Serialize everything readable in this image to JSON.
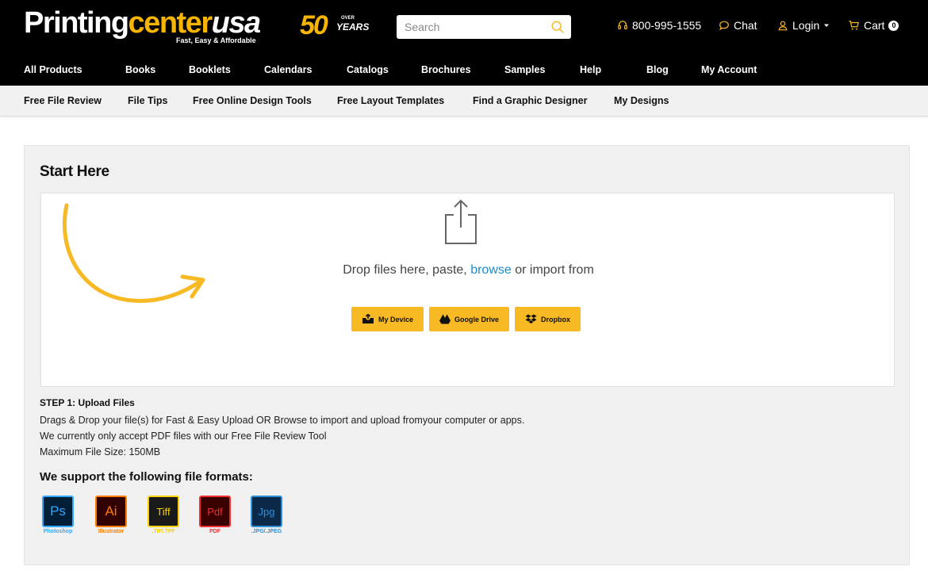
{
  "header": {
    "logo": {
      "part1": "Printing",
      "part2": "center",
      "part3": "usa",
      "tagline": "Fast, Easy & Affordable"
    },
    "anniversary": {
      "number": "50",
      "over": "OVER",
      "years": "YEARS"
    },
    "search": {
      "placeholder": "Search",
      "value": ""
    },
    "phone": "800-995-1555",
    "chat": "Chat",
    "login": "Login",
    "cart": {
      "label": "Cart",
      "count": "0"
    }
  },
  "main_nav": [
    "All Products",
    "Books",
    "Booklets",
    "Calendars",
    "Catalogs",
    "Brochures",
    "Samples",
    "Help",
    "Blog",
    "My Account"
  ],
  "sub_nav": [
    "Free File Review",
    "File Tips",
    "Free Online Design Tools",
    "Free Layout Templates",
    "Find a Graphic Designer",
    "My Designs"
  ],
  "upload": {
    "title": "Start Here",
    "drop_prefix": "Drop files here, paste, ",
    "browse": "browse",
    "drop_suffix": " or import from",
    "buttons": {
      "device": "My Device",
      "gdrive": "Google Drive",
      "dropbox": "Dropbox"
    }
  },
  "step": {
    "title": "STEP 1: Upload Files",
    "lines": [
      "Drags & Drop your file(s) for Fast & Easy Upload OR Browse to import and upload fromyour computer or apps.",
      "We currently only accept PDF files with our Free File Review Tool",
      "Maximum File Size: 150MB"
    ]
  },
  "formats": {
    "title": "We support the following file formats:",
    "items": [
      {
        "icon": "Ps",
        "label": "Photoshop",
        "color": "#31a8ff",
        "bg": "#001e36"
      },
      {
        "icon": "Ai",
        "label": "Illustrator",
        "color": "#ff7c00",
        "bg": "#330000"
      },
      {
        "icon": "Tiff",
        "label": ".TIF/.TFF",
        "color": "#f7d000",
        "bg": "#1a1a1a"
      },
      {
        "icon": "Pdf",
        "label": "PDF",
        "color": "#f03030",
        "bg": "#3a0000"
      },
      {
        "icon": "Jpg",
        "label": ".JPG/.JPEG",
        "color": "#2e90d8",
        "bg": "#0b2a4a"
      }
    ]
  },
  "colors": {
    "accent": "#f7b924",
    "link": "#1a8dd0",
    "header_bg": "#000000"
  }
}
